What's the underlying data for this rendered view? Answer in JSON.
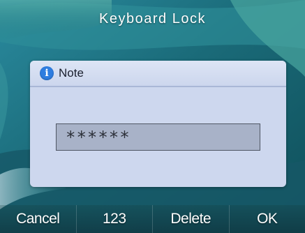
{
  "window": {
    "title": "Keyboard Lock"
  },
  "dialog": {
    "icon": "info-icon",
    "title": "Note",
    "password_value": "******",
    "colors": {
      "background": "#cdd7ee",
      "icon": "#2e7de0"
    }
  },
  "softkeys": {
    "cancel": "Cancel",
    "numeric": "123",
    "delete": "Delete",
    "ok": "OK"
  }
}
